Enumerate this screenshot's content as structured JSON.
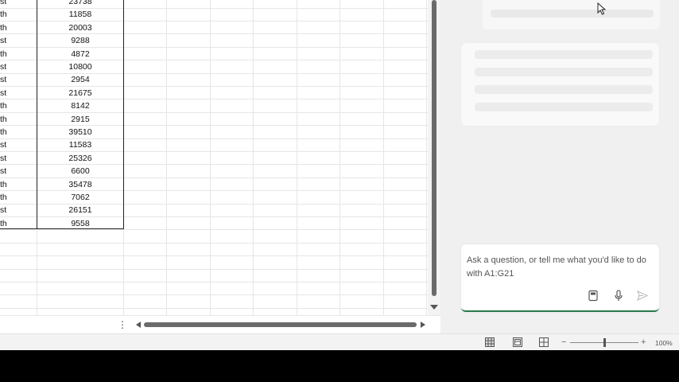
{
  "sheet": {
    "rows": [
      {
        "region": "st",
        "value": "23738"
      },
      {
        "region": "th",
        "value": "11858"
      },
      {
        "region": "th",
        "value": "20003"
      },
      {
        "region": "st",
        "value": "9288"
      },
      {
        "region": "th",
        "value": "4872"
      },
      {
        "region": "st",
        "value": "10800"
      },
      {
        "region": "st",
        "value": "2954"
      },
      {
        "region": "st",
        "value": "21675"
      },
      {
        "region": "th",
        "value": "8142"
      },
      {
        "region": "th",
        "value": "2915"
      },
      {
        "region": "th",
        "value": "39510"
      },
      {
        "region": "st",
        "value": "11583"
      },
      {
        "region": "st",
        "value": "25326"
      },
      {
        "region": "st",
        "value": "6600"
      },
      {
        "region": "th",
        "value": "35478"
      },
      {
        "region": "th",
        "value": "7062"
      },
      {
        "region": "st",
        "value": "26151"
      },
      {
        "region": "th",
        "value": "9558"
      }
    ]
  },
  "status_bar": {
    "view_icons": [
      "normal-view-icon",
      "page-layout-view-icon",
      "page-break-preview-icon"
    ],
    "zoom_minus": "−",
    "zoom_plus": "+",
    "zoom_level": "100%"
  },
  "copilot": {
    "compose_placeholder": "Ask a question, or tell me what you'd like to do with A1:G21",
    "icons": [
      "prompt-guide-icon",
      "microphone-icon",
      "send-icon"
    ]
  },
  "colors": {
    "accent": "#2b7a4b",
    "pane_background": "#f0f0f0",
    "table_border": "#222222"
  }
}
